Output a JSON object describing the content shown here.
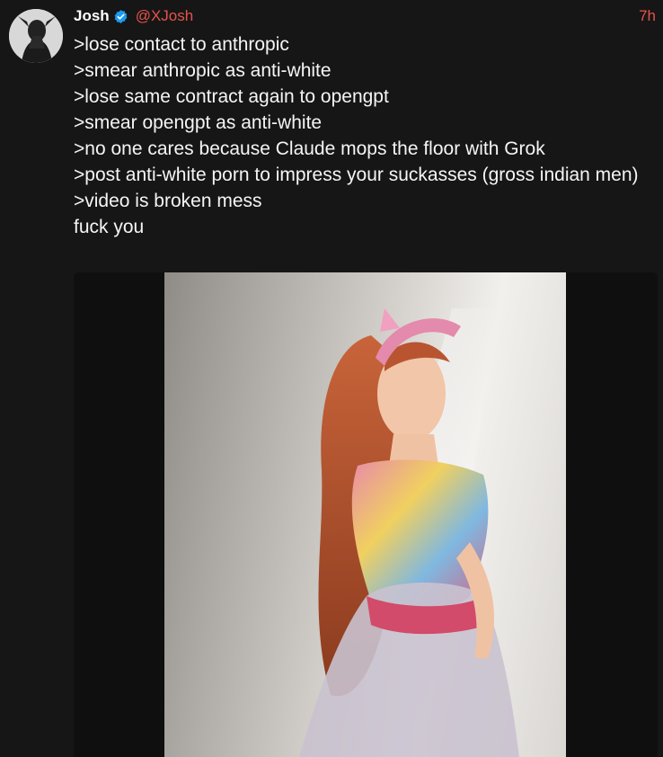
{
  "post": {
    "author_name": "Josh",
    "author_handle": "@XJosh",
    "timestamp": "7h",
    "verified_icon": "verified-badge-icon",
    "lines": [
      ">lose contact to anthropic",
      ">smear anthropic as anti-white",
      ">lose same contract again to opengpt",
      ">smear opengpt as anti-white",
      ">no one cares because Claude mops the floor with Grok",
      ">post anti-white porn to impress your suckasses (gross indian men)",
      ">video is broken mess",
      "fuck you"
    ]
  },
  "colors": {
    "background": "#161616",
    "accent_red": "#e5534b",
    "verified_blue": "#1d9bf0",
    "text": "#f5f5f5"
  }
}
